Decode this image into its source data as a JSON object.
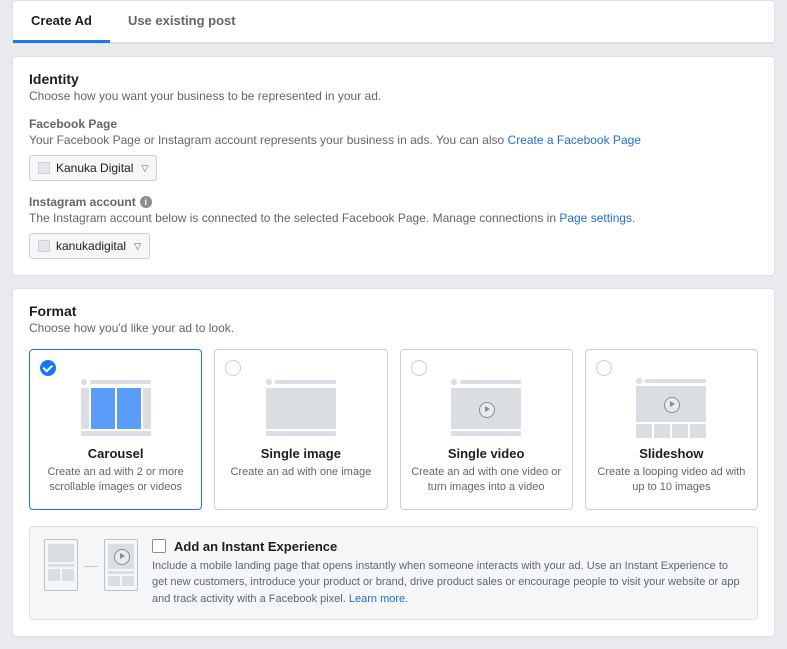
{
  "tabs": {
    "create": "Create Ad",
    "existing": "Use existing post"
  },
  "identity": {
    "title": "Identity",
    "subtitle": "Choose how you want your business to be represented in your ad.",
    "fb_label": "Facebook Page",
    "fb_desc": "Your Facebook Page or Instagram account represents your business in ads. You can also ",
    "fb_link": "Create a Facebook Page",
    "fb_page_selected": "Kanuka Digital",
    "ig_label": "Instagram account",
    "ig_desc_pre": "The Instagram account below is connected to the selected Facebook Page. Manage connections in ",
    "ig_link": "Page settings",
    "ig_desc_post": ".",
    "ig_selected": "kanukadigital"
  },
  "format": {
    "title": "Format",
    "subtitle": "Choose how you'd like your ad to look.",
    "options": [
      {
        "name": "Carousel",
        "desc": "Create an ad with 2 or more scrollable images or videos",
        "selected": true
      },
      {
        "name": "Single image",
        "desc": "Create an ad with one image",
        "selected": false
      },
      {
        "name": "Single video",
        "desc": "Create an ad with one video or turn images into a video",
        "selected": false
      },
      {
        "name": "Slideshow",
        "desc": "Create a looping video ad with up to 10 images",
        "selected": false
      }
    ]
  },
  "instant": {
    "title": "Add an Instant Experience",
    "desc": "Include a mobile landing page that opens instantly when someone interacts with your ad. Use an Instant Experience to get new customers, introduce your product or brand, drive product sales or encourage people to visit your website or app and track activity with a Facebook pixel. ",
    "link": "Learn more."
  }
}
